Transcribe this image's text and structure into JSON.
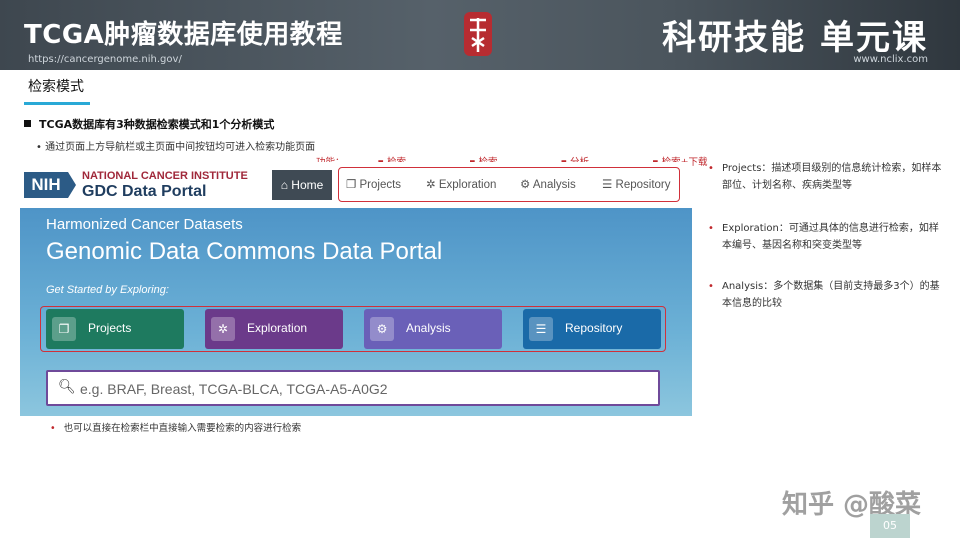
{
  "header": {
    "title": "TCGA肿瘤数据库使用教程",
    "url_left": "https://cancergenome.nih.gov/",
    "right_title": "科研技能 单元课",
    "url_right": "www.nclix.com"
  },
  "section_tab": "检索模式",
  "bullet_main": "TCGA数据库有3种数据检索模式和1个分析模式",
  "sub_bullet": "通过页面上方导航栏或主页面中间按钮均可进入检索功能页面",
  "mode_labels": [
    "功能：",
    "检索",
    "检索",
    "分析",
    "检索+下载"
  ],
  "gdc": {
    "nih": "NIH",
    "institute": "NATIONAL CANCER INSTITUTE",
    "portal": "GDC Data Portal",
    "nav": {
      "home": "Home",
      "projects": "Projects",
      "exploration": "Exploration",
      "analysis": "Analysis",
      "repository": "Repository"
    },
    "hero_sub": "Harmonized Cancer Datasets",
    "hero_title": "Genomic Data Commons Data Portal",
    "get_started": "Get Started by Exploring:",
    "cards": {
      "projects": "Projects",
      "exploration": "Exploration",
      "analysis": "Analysis",
      "repository": "Repository"
    },
    "search_placeholder": "e.g. BRAF, Breast, TCGA-BLCA, TCGA-A5-A0G2"
  },
  "under_note": "也可以直接在检索栏中直接输入需要检索的内容进行检索",
  "notes": [
    "Projects：描述项目级别的信息统计检索，如样本部位、计划名称、疾病类型等",
    "Exploration：可通过具体的信息进行检索，如样本编号、基因名称和突变类型等",
    "Analysis：多个数据集（目前支持最多3个）的基本信息的比较"
  ],
  "watermark": "知乎 @酸菜",
  "page_number": "05",
  "colors": {
    "accent_red": "#d0303a",
    "tab_underline": "#29a9d6",
    "projects": "#1e7a5f",
    "exploration": "#6b3a8a",
    "analysis": "#6a60b8",
    "repository": "#1a6aa8"
  }
}
